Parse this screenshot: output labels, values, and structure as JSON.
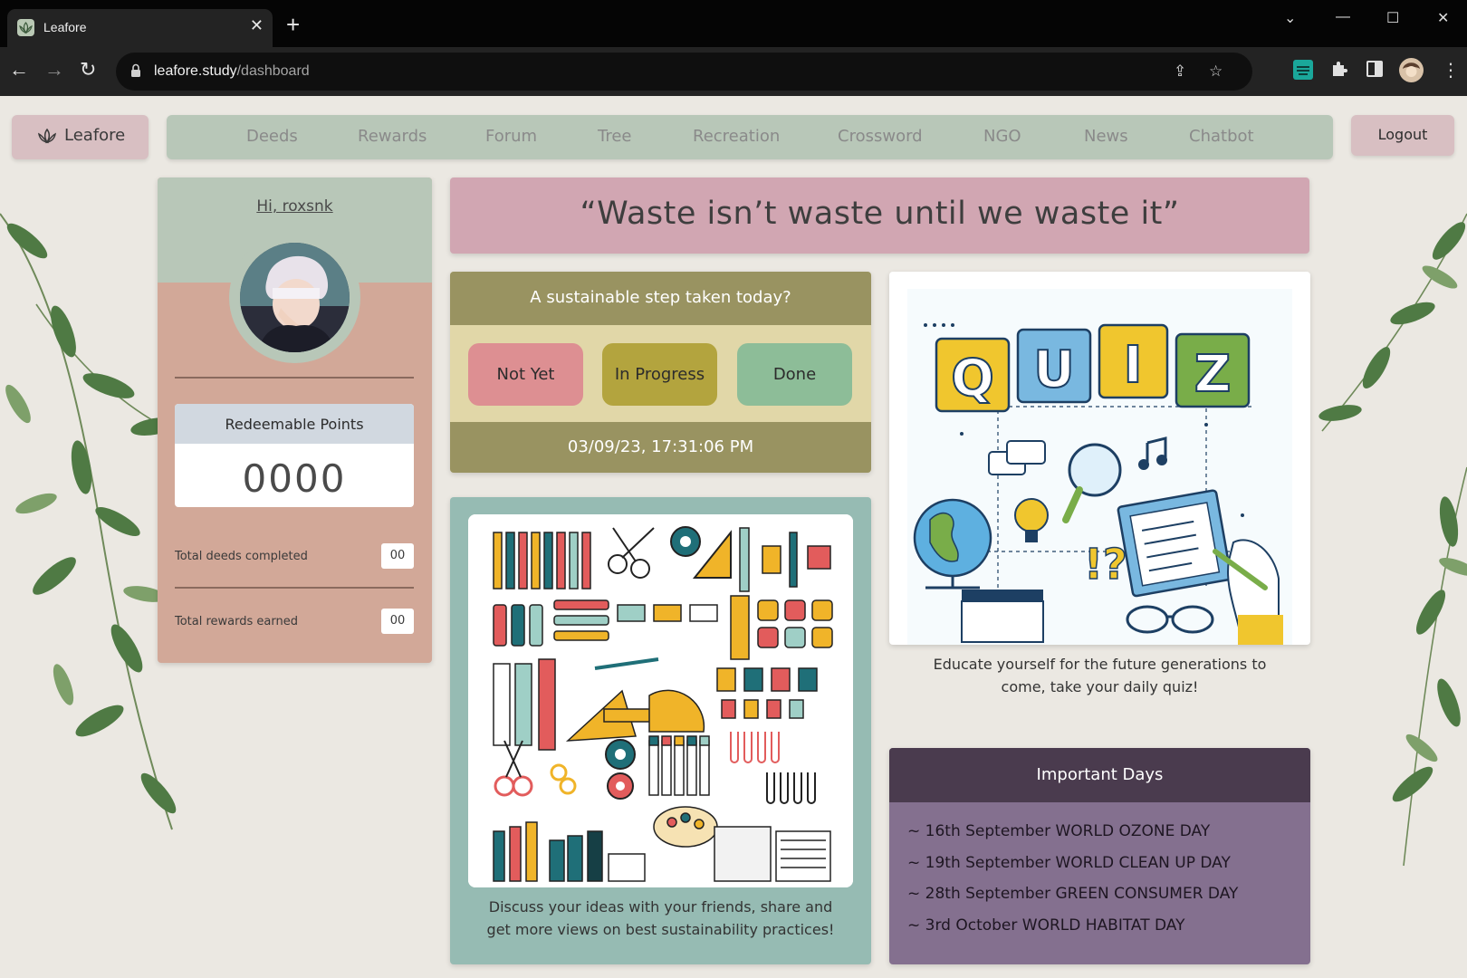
{
  "browser": {
    "tab_title": "Leafore",
    "tab_close": "✕",
    "new_tab": "+",
    "url_host": "leafore.study",
    "url_path": "/dashboard",
    "window_controls": [
      "⌄",
      "—",
      "☐",
      "✕"
    ]
  },
  "brand": {
    "label": "Leafore",
    "icon": "lotus-icon"
  },
  "nav": {
    "items": [
      "Deeds",
      "Rewards",
      "Forum",
      "Tree",
      "Recreation",
      "Crossword",
      "NGO",
      "News",
      "Chatbot"
    ]
  },
  "logout_label": "Logout",
  "profile": {
    "greeting": "Hi, roxsnk",
    "points_title": "Redeemable Points",
    "points_value": "0000",
    "deeds_label": "Total deeds completed",
    "deeds_value": "00",
    "rewards_label": "Total rewards earned",
    "rewards_value": "00"
  },
  "quote": "“Waste isn’t waste until we waste it”",
  "step": {
    "title": "A sustainable step taken today?",
    "buttons": [
      "Not Yet",
      "In Progress",
      "Done"
    ],
    "timestamp": "03/09/23, 17:31:06 PM"
  },
  "forum": {
    "caption": "Discuss your ideas with your friends, share and get more views on best sustainability practices!"
  },
  "quiz": {
    "letters": [
      "Q",
      "U",
      "I",
      "Z"
    ],
    "caption": "Educate yourself for the future generations to come, take your daily quiz!"
  },
  "days": {
    "title": "Important Days",
    "items": [
      "~ 16th September WORLD OZONE DAY",
      "~ 19th September WORLD CLEAN UP DAY",
      "~ 28th September GREEN CONSUMER DAY",
      "~ 3rd October WORLD HABITAT DAY"
    ]
  },
  "colors": {
    "page_bg": "#ebe8e2",
    "nav_bg": "#b8c7b8",
    "brand_bg": "#d8bfc2",
    "profile_bg": "#d2a898",
    "quote_bg": "#d1a6b2",
    "olive": "#999361",
    "not_yet": "#dd8f92",
    "in_progress": "#b3a43e",
    "done": "#8dbd98",
    "forum_bg": "#96bbb3",
    "days_head": "#4a3b4e",
    "days_bg": "#84708f"
  }
}
